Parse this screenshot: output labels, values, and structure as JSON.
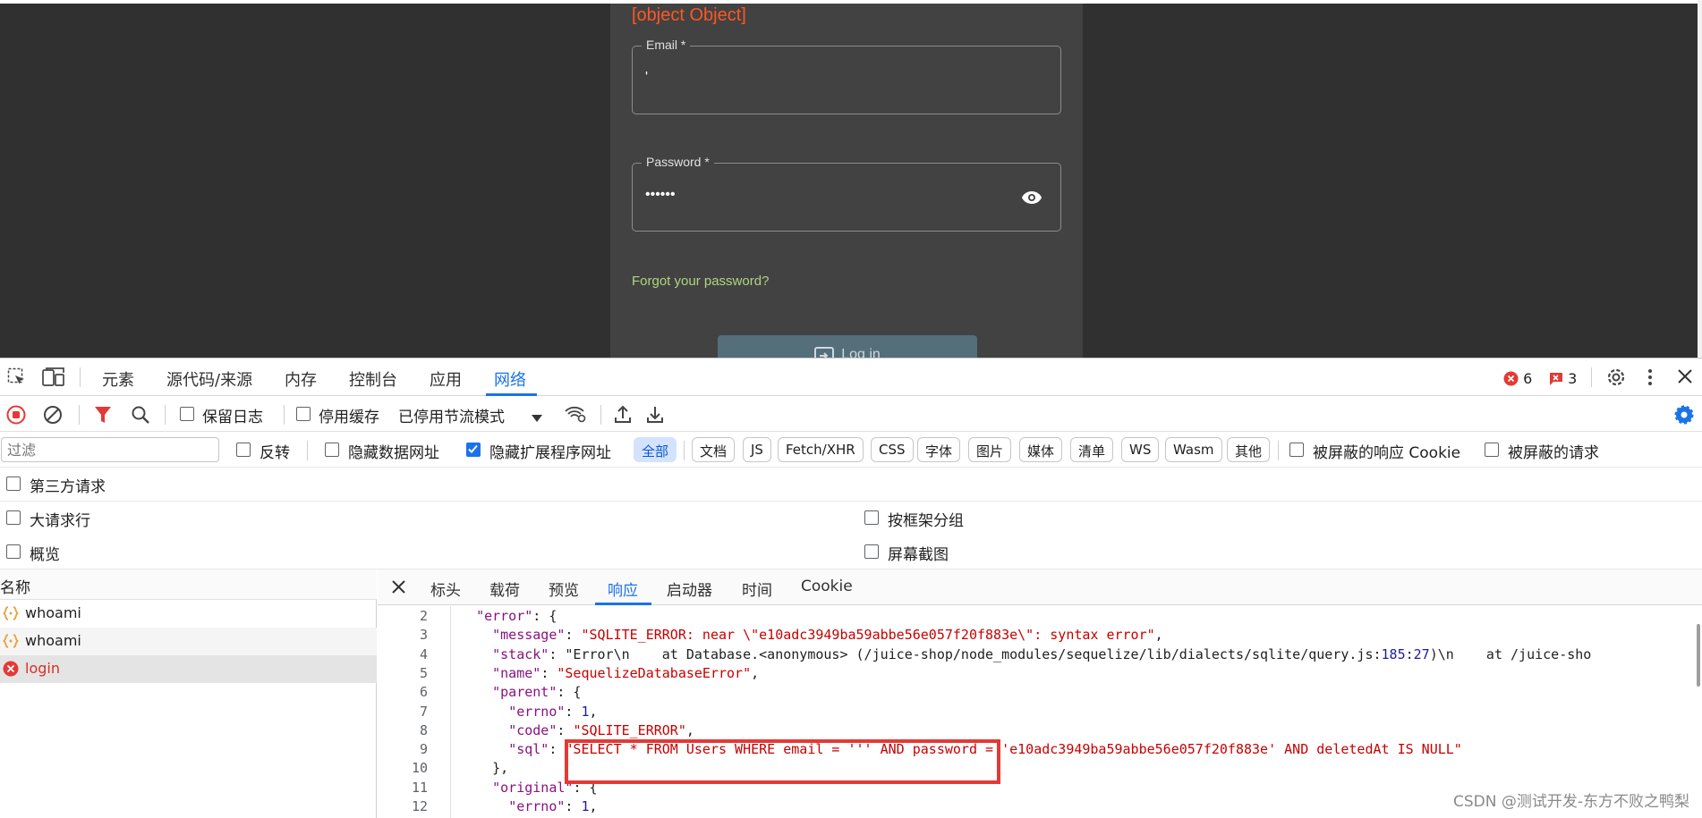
{
  "app": {
    "error_message": "[object Object]",
    "email_label": "Email *",
    "email_value": "'",
    "password_label": "Password *",
    "password_value": "••••••",
    "forgot_link": "Forgot your password?",
    "login_button": "Log in",
    "colors": {
      "error": "#ff5722",
      "link": "#aed581",
      "card": "#424242",
      "background": "#303030"
    }
  },
  "devtools": {
    "tabs": [
      "元素",
      "源代码/来源",
      "内存",
      "控制台",
      "应用",
      "网络"
    ],
    "active_tab": "网络",
    "error_count": "6",
    "warning_count": "3",
    "toolbar": {
      "preserve_log": "保留日志",
      "disable_cache": "停用缓存",
      "throttling": "已停用节流模式"
    },
    "filter": {
      "placeholder": "过滤",
      "invert": "反转",
      "hide_data_urls": "隐藏数据网址",
      "hide_extension_urls": "隐藏扩展程序网址",
      "types": [
        "全部",
        "文档",
        "JS",
        "Fetch/XHR",
        "CSS",
        "字体",
        "图片",
        "媒体",
        "清单",
        "WS",
        "Wasm",
        "其他"
      ],
      "blocked_cookies": "被屏蔽的响应 Cookie",
      "blocked_requests": "被屏蔽的请求",
      "third_party": "第三方请求"
    },
    "options": {
      "big_rows": "大请求行",
      "group_by_frame": "按框架分组",
      "overview": "概览",
      "screenshots": "屏幕截图"
    },
    "requests": {
      "header": "名称",
      "items": [
        {
          "name": "whoami",
          "status": "ok"
        },
        {
          "name": "whoami",
          "status": "ok"
        },
        {
          "name": "login",
          "status": "error"
        }
      ]
    },
    "detail_tabs": [
      "标头",
      "载荷",
      "预览",
      "响应",
      "启动器",
      "时间",
      "Cookie"
    ],
    "active_detail_tab": "响应",
    "response_lines": [
      {
        "n": "2",
        "t": "  \"error\": {"
      },
      {
        "n": "3",
        "t": "    \"message\": \"SQLITE_ERROR: near \\\"e10adc3949ba59abbe56e057f20f883e\\\": syntax error\","
      },
      {
        "n": "4",
        "t": "    \"stack\": \"Error\\n    at Database.<anonymous> (/juice-shop/node_modules/sequelize/lib/dialects/sqlite/query.js:185:27)\\n    at /juice-sho"
      },
      {
        "n": "5",
        "t": "    \"name\": \"SequelizeDatabaseError\","
      },
      {
        "n": "6",
        "t": "    \"parent\": {"
      },
      {
        "n": "7",
        "t": "      \"errno\": 1,"
      },
      {
        "n": "8",
        "t": "      \"code\": \"SQLITE_ERROR\","
      },
      {
        "n": "9",
        "t": "      \"sql\": \"SELECT * FROM Users WHERE email = ''' AND password = 'e10adc3949ba59abbe56e057f20f883e' AND deletedAt IS NULL\""
      },
      {
        "n": "10",
        "t": "    },"
      },
      {
        "n": "11",
        "t": "    \"original\": {"
      },
      {
        "n": "12",
        "t": "      \"errno\": 1,"
      }
    ]
  },
  "watermark": "CSDN @测试开发-东方不败之鸭梨"
}
